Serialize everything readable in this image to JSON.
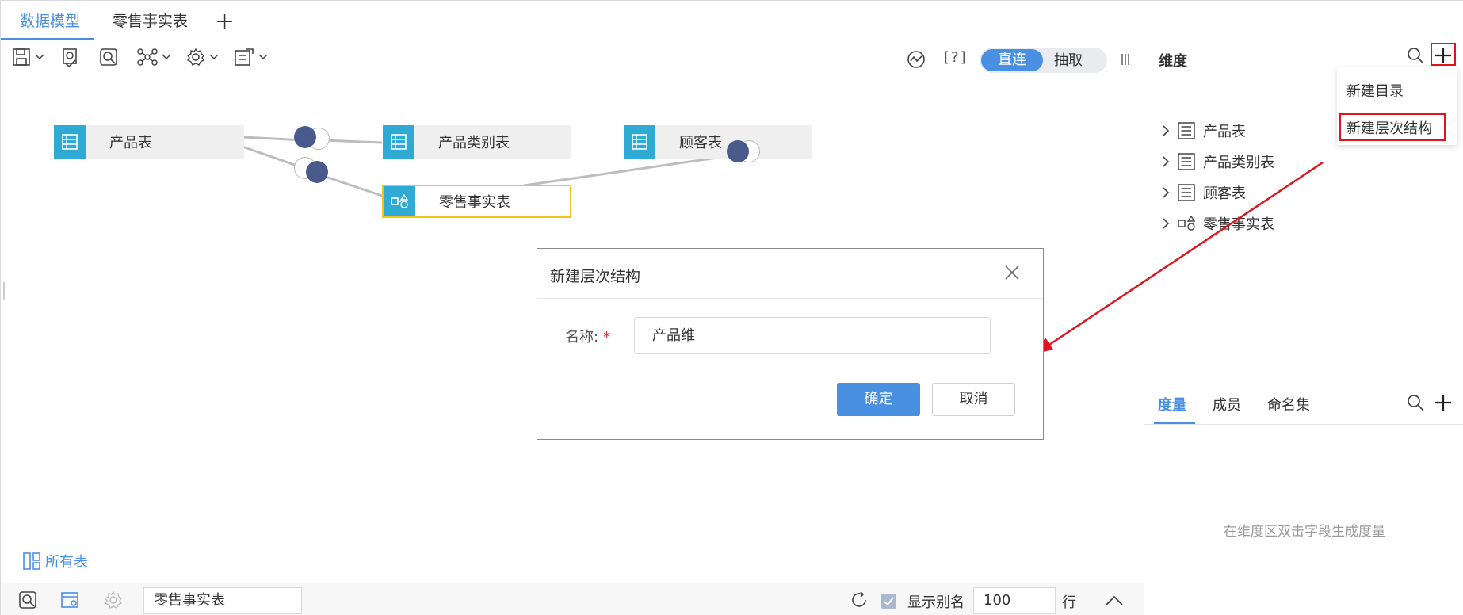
{
  "tabs": [
    {
      "label": "数据模型"
    },
    {
      "label": "零售事实表"
    }
  ],
  "toolbar": {
    "mode_direct": "直连",
    "mode_extract": "抽取",
    "help": "[?]"
  },
  "canvas": {
    "tables": [
      {
        "label": "产品表",
        "kind": "table"
      },
      {
        "label": "产品类别表",
        "kind": "table"
      },
      {
        "label": "顾客表",
        "kind": "table"
      },
      {
        "label": "零售事实表",
        "kind": "fact"
      }
    ],
    "all_tables": "所有表"
  },
  "statusbar": {
    "current_table": "零售事实表",
    "show_alias": "显示别名",
    "rows": "100",
    "rows_unit": "行"
  },
  "dimension_panel": {
    "title": "维度",
    "items": [
      {
        "label": "产品表",
        "icon": "table-icon"
      },
      {
        "label": "产品类别表",
        "icon": "table-icon"
      },
      {
        "label": "顾客表",
        "icon": "table-icon"
      },
      {
        "label": "零售事实表",
        "icon": "fact-table-icon"
      }
    ],
    "menu": {
      "new_folder": "新建目录",
      "new_hierarchy": "新建层次结构"
    }
  },
  "measure_panel": {
    "tabs": [
      {
        "label": "度量"
      },
      {
        "label": "成员"
      },
      {
        "label": "命名集"
      }
    ],
    "empty_hint": "在维度区双击字段生成度量"
  },
  "dialog": {
    "title": "新建层次结构",
    "name_label": "名称:",
    "required_mark": "*",
    "name_value": "产品维",
    "ok": "确定",
    "cancel": "取消"
  },
  "colors": {
    "accent": "#4a90e2",
    "table_icon": "#2eaad4",
    "joint": "#4a5a8c",
    "selection": "#f0c419",
    "annotation": "#e0141e"
  }
}
